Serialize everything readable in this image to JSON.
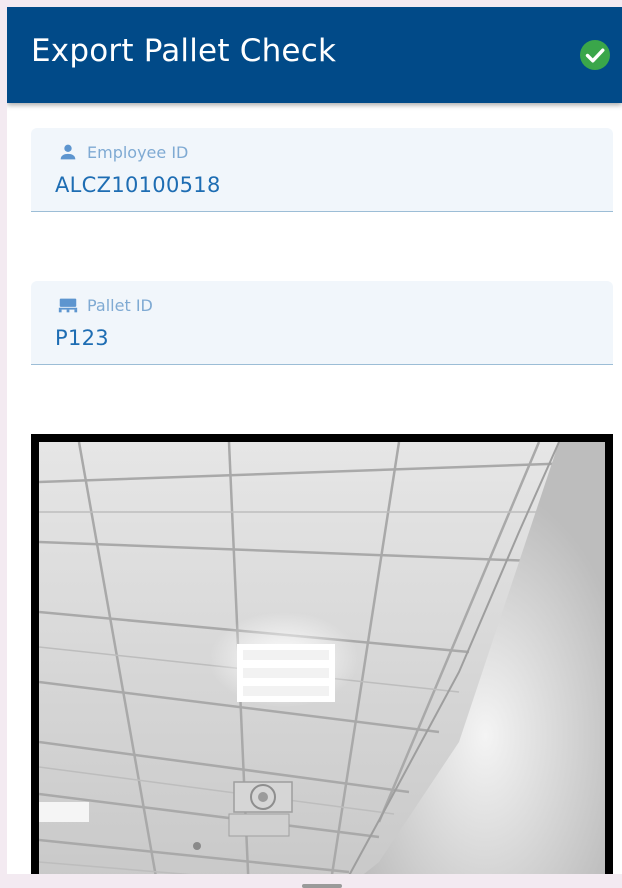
{
  "header": {
    "title": "Export Pallet Check",
    "status_icon": "check-circle-icon",
    "status_color": "#3aa64a",
    "background": "#014a88"
  },
  "form": {
    "employee": {
      "label": "Employee ID",
      "icon": "person-icon",
      "value": "ALCZ10100518"
    },
    "pallet": {
      "label": "Pallet ID",
      "icon": "pallet-icon",
      "value": "P123"
    }
  },
  "camera": {
    "icon": "camera-preview"
  }
}
